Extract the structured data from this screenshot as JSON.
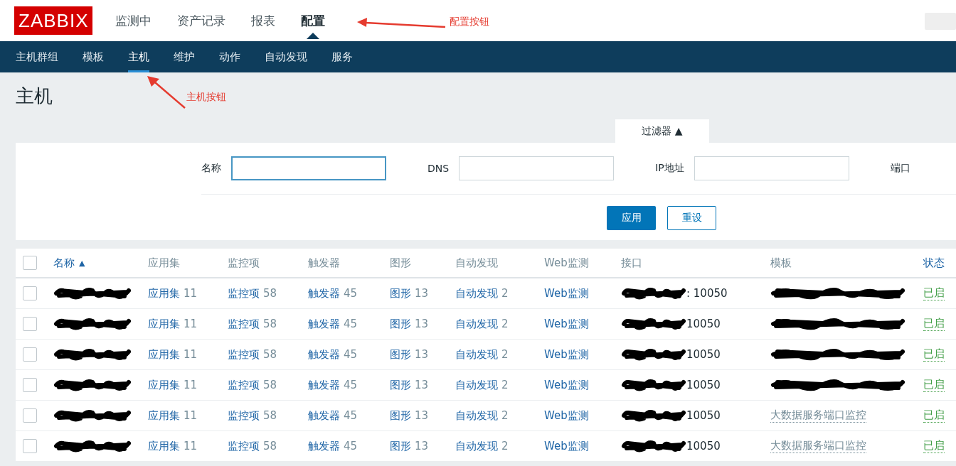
{
  "header": {
    "logo": "ZABBIX",
    "menu": [
      {
        "label": "监测中",
        "selected": false
      },
      {
        "label": "资产记录",
        "selected": false
      },
      {
        "label": "报表",
        "selected": false
      },
      {
        "label": "配置",
        "selected": true
      }
    ]
  },
  "subnav": [
    {
      "label": "主机群组",
      "selected": false
    },
    {
      "label": "模板",
      "selected": false
    },
    {
      "label": "主机",
      "selected": true
    },
    {
      "label": "维护",
      "selected": false
    },
    {
      "label": "动作",
      "selected": false
    },
    {
      "label": "自动发现",
      "selected": false
    },
    {
      "label": "服务",
      "selected": false
    }
  ],
  "page_title": "主机",
  "filter": {
    "tab": "过滤器 ▲",
    "fields": [
      {
        "label": "名称",
        "focused": true
      },
      {
        "label": "DNS",
        "focused": false
      },
      {
        "label": "IP地址",
        "focused": false
      }
    ],
    "cut_label": "端口",
    "apply": "应用",
    "reset": "重设"
  },
  "table": {
    "all_checked": false,
    "columns": [
      {
        "label": "名称",
        "sort": "▲",
        "sortable": true
      },
      {
        "label": "应用集",
        "sortable": false
      },
      {
        "label": "监控项",
        "sortable": false
      },
      {
        "label": "触发器",
        "sortable": false
      },
      {
        "label": "图形",
        "sortable": false
      },
      {
        "label": "自动发现",
        "sortable": false
      },
      {
        "label": "Web监测",
        "sortable": false
      },
      {
        "label": "接口",
        "sortable": false
      },
      {
        "label": "模板",
        "sortable": false
      },
      {
        "label": "状态",
        "sortable": true
      }
    ],
    "rows": [
      {
        "checked": false,
        "name_redacted": true,
        "links": [
          {
            "label": "应用集",
            "count": "11"
          },
          {
            "label": "监控项",
            "count": "58"
          },
          {
            "label": "触发器",
            "count": "45"
          },
          {
            "label": "图形",
            "count": "13"
          },
          {
            "label": "自动发现",
            "count": "2"
          },
          {
            "label": "Web监测"
          }
        ],
        "interface": ": 10050",
        "template_redacted": true,
        "status": "已启"
      },
      {
        "checked": false,
        "name_redacted": true,
        "links": [
          {
            "label": "应用集",
            "count": "11"
          },
          {
            "label": "监控项",
            "count": "58"
          },
          {
            "label": "触发器",
            "count": "45"
          },
          {
            "label": "图形",
            "count": "13"
          },
          {
            "label": "自动发现",
            "count": "2"
          },
          {
            "label": "Web监测"
          }
        ],
        "interface": "10050",
        "template_redacted": true,
        "status": "已启"
      },
      {
        "checked": false,
        "name_redacted": true,
        "links": [
          {
            "label": "应用集",
            "count": "11"
          },
          {
            "label": "监控项",
            "count": "58"
          },
          {
            "label": "触发器",
            "count": "45"
          },
          {
            "label": "图形",
            "count": "13"
          },
          {
            "label": "自动发现",
            "count": "2"
          },
          {
            "label": "Web监测"
          }
        ],
        "interface": "10050",
        "template_redacted": true,
        "status": "已启"
      },
      {
        "checked": false,
        "name_redacted": true,
        "links": [
          {
            "label": "应用集",
            "count": "11"
          },
          {
            "label": "监控项",
            "count": "58"
          },
          {
            "label": "触发器",
            "count": "45"
          },
          {
            "label": "图形",
            "count": "13"
          },
          {
            "label": "自动发现",
            "count": "2"
          },
          {
            "label": "Web监测"
          }
        ],
        "interface": "10050",
        "template_redacted": true,
        "status": "已启"
      },
      {
        "checked": false,
        "name_redacted": true,
        "links": [
          {
            "label": "应用集",
            "count": "11"
          },
          {
            "label": "监控项",
            "count": "58"
          },
          {
            "label": "触发器",
            "count": "45"
          },
          {
            "label": "图形",
            "count": "13"
          },
          {
            "label": "自动发现",
            "count": "2"
          },
          {
            "label": "Web监测"
          }
        ],
        "interface": "10050",
        "template_redacted": false,
        "template": "大数据服务端口监控",
        "status": "已启"
      },
      {
        "checked": false,
        "name_redacted": true,
        "links": [
          {
            "label": "应用集",
            "count": "11"
          },
          {
            "label": "监控项",
            "count": "58"
          },
          {
            "label": "触发器",
            "count": "45"
          },
          {
            "label": "图形",
            "count": "13"
          },
          {
            "label": "自动发现",
            "count": "2"
          },
          {
            "label": "Web监测"
          }
        ],
        "interface": "10050",
        "template_redacted": false,
        "template": "大数据服务端口监控",
        "status": "已启"
      }
    ]
  },
  "annotations": [
    {
      "text": "配置按钮"
    },
    {
      "text": "主机按钮"
    }
  ]
}
